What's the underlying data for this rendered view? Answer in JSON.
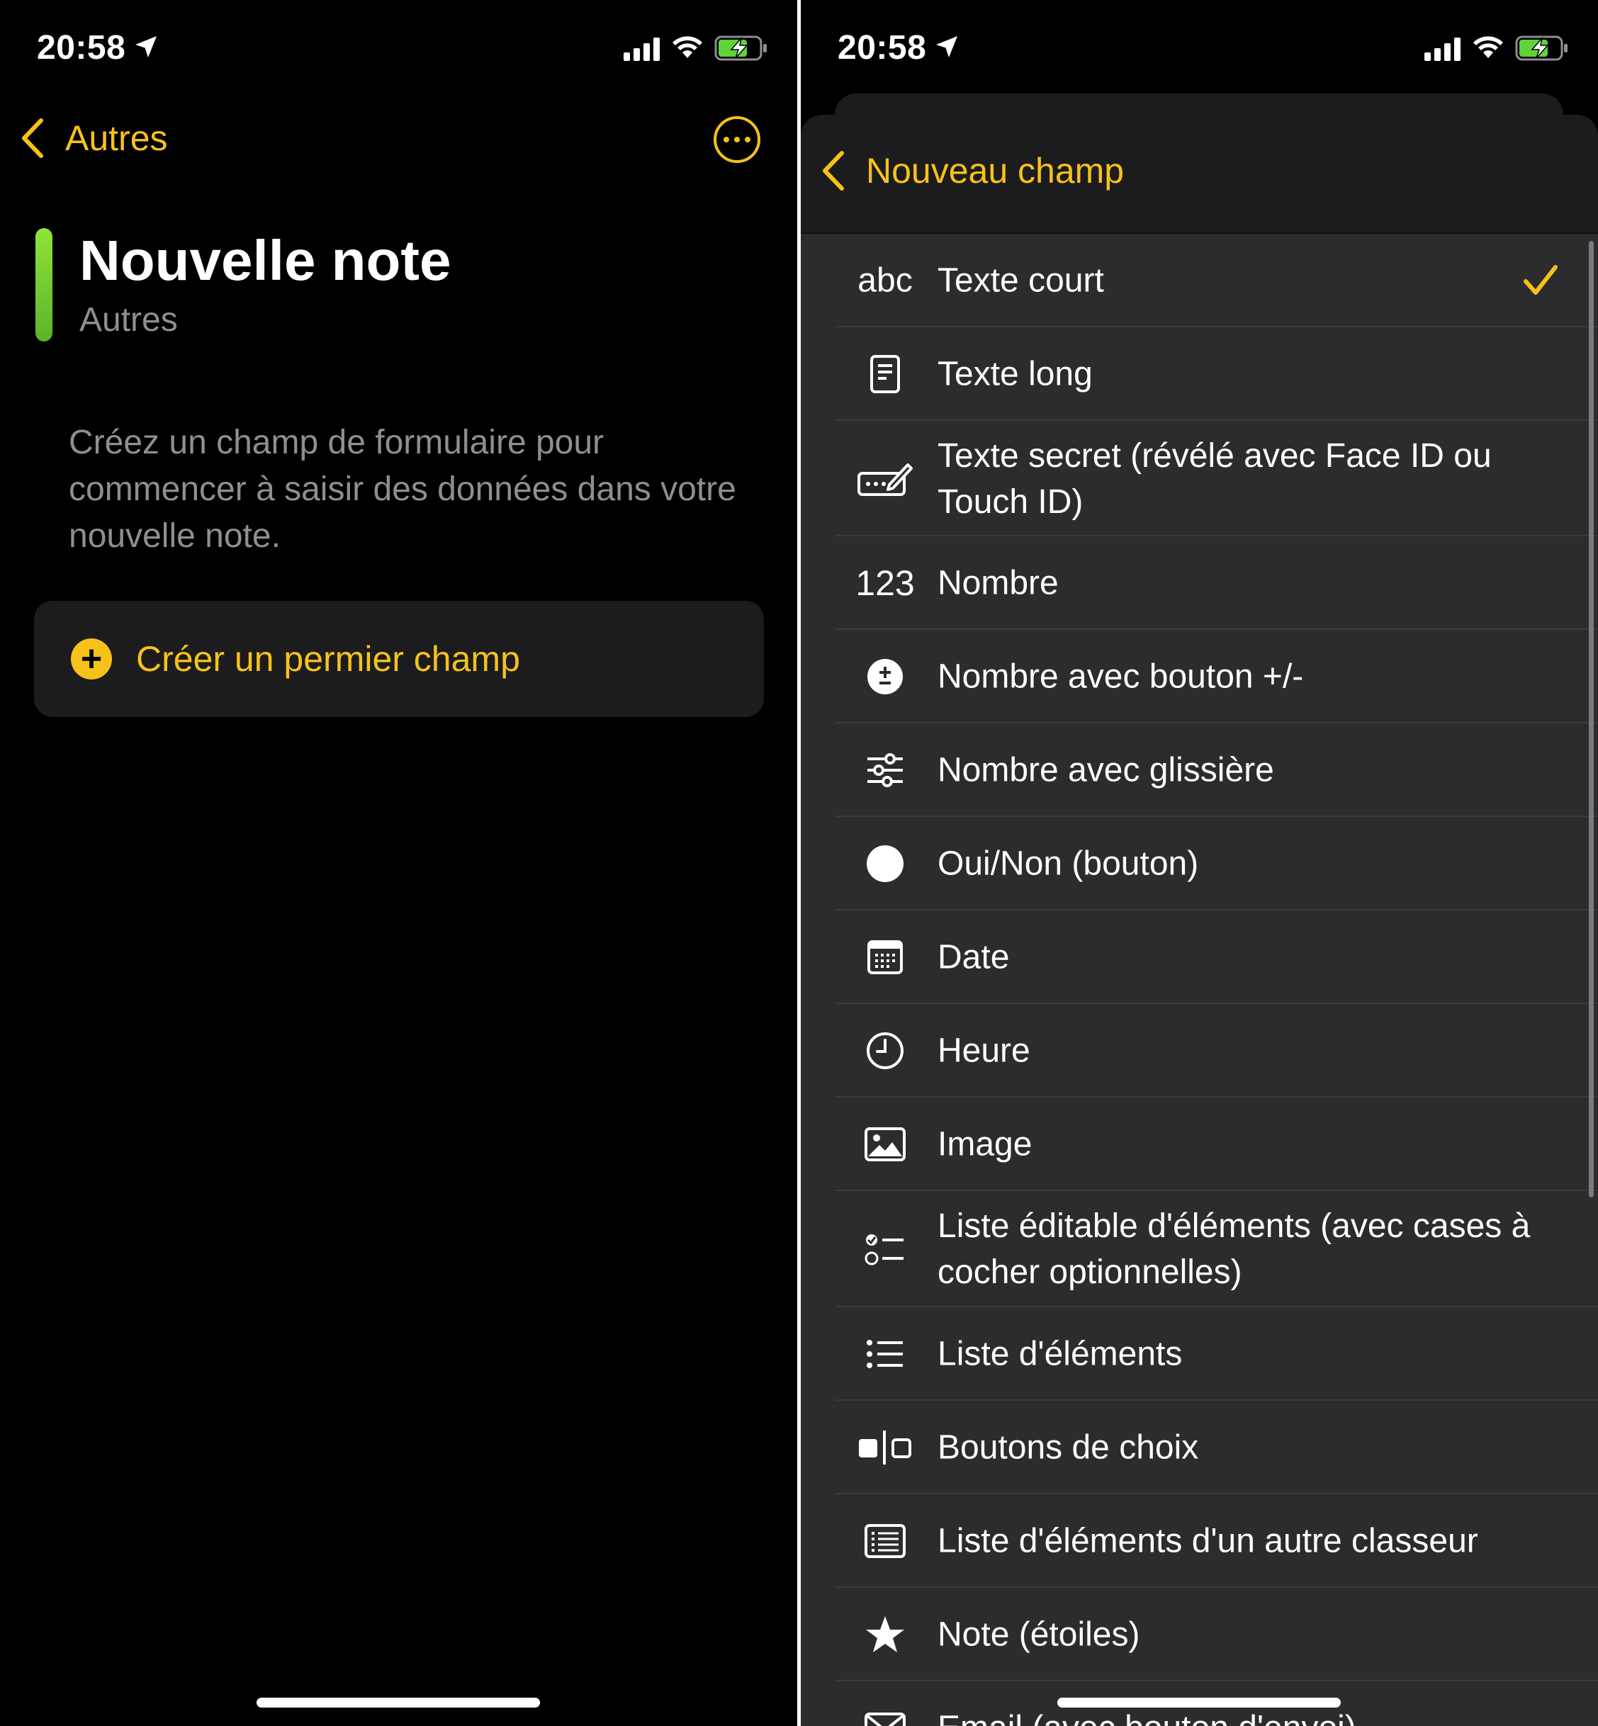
{
  "colors": {
    "accent": "#f6c21a",
    "green": "#8fe43a",
    "background": "#000000",
    "sheet": "#1c1c1e",
    "list": "#2c2c2e"
  },
  "status_bar": {
    "time": "20:58"
  },
  "left": {
    "back_label": "Autres",
    "title": "Nouvelle note",
    "subtitle": "Autres",
    "hint": "Créez un champ de formulaire pour commencer à saisir des données dans votre nouvelle note.",
    "create_button": "Créer un permier champ"
  },
  "right": {
    "back_label": "Nouveau champ",
    "items": [
      {
        "icon": "abc-text-icon",
        "label": "Texte court",
        "selected": true
      },
      {
        "icon": "document-icon",
        "label": "Texte long"
      },
      {
        "icon": "password-field-icon",
        "label": "Texte secret (révélé avec Face ID ou Touch ID)"
      },
      {
        "icon": "number-123-icon",
        "label": "Nombre"
      },
      {
        "icon": "plus-minus-circle-icon",
        "label": "Nombre avec bouton +/-"
      },
      {
        "icon": "sliders-icon",
        "label": "Nombre avec glissière"
      },
      {
        "icon": "toggle-circle-icon",
        "label": "Oui/Non (bouton)"
      },
      {
        "icon": "calendar-icon",
        "label": "Date"
      },
      {
        "icon": "clock-icon",
        "label": "Heure"
      },
      {
        "icon": "image-icon",
        "label": "Image"
      },
      {
        "icon": "checklist-icon",
        "label": "Liste éditable d'éléments (avec cases à cocher optionnelles)"
      },
      {
        "icon": "list-bullet-icon",
        "label": "Liste d'éléments"
      },
      {
        "icon": "choice-buttons-icon",
        "label": "Boutons de choix"
      },
      {
        "icon": "list-box-icon",
        "label": "Liste d'éléments d'un autre classeur"
      },
      {
        "icon": "star-icon",
        "label": "Note (étoiles)"
      },
      {
        "icon": "envelope-icon",
        "label": "Email (avec bouton d'envoi)"
      }
    ]
  }
}
